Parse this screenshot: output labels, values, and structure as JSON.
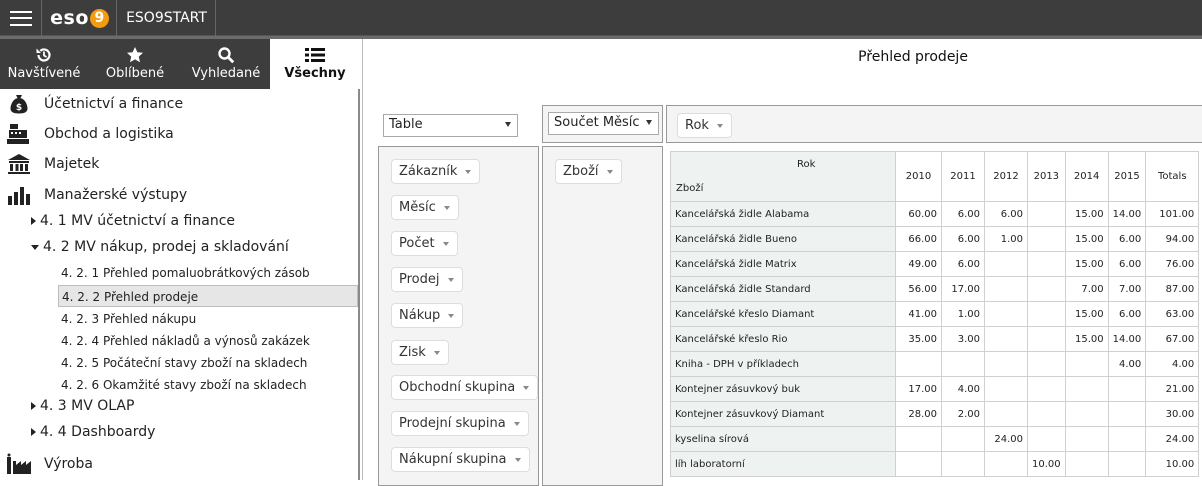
{
  "topbar": {
    "logo_text": "eso",
    "logo_digit": "9",
    "app_title": "ESO9START"
  },
  "tabs": [
    {
      "label": "Navštívené",
      "icon": "history-icon"
    },
    {
      "label": "Oblíbené",
      "icon": "star-icon"
    },
    {
      "label": "Vyhledané",
      "icon": "search-icon"
    },
    {
      "label": "Všechny",
      "icon": "list-icon"
    }
  ],
  "menu": {
    "top": [
      {
        "label": "Účetnictví a finance",
        "icon": "money-bag-icon"
      },
      {
        "label": "Obchod a logistika",
        "icon": "cash-register-icon"
      },
      {
        "label": "Majetek",
        "icon": "building-icon"
      },
      {
        "label": "Manažerské výstupy",
        "icon": "bar-chart-icon"
      }
    ],
    "sub1": "4. 1 MV účetnictví a finance",
    "sub2": "4. 2 MV nákup, prodej a skladování",
    "leaves": [
      "4. 2. 1 Přehled pomaluobrátkových zásob",
      "4. 2. 2 Přehled prodeje",
      "4. 2. 3 Přehled nákupu",
      "4. 2. 4 Přehled nákladů a výnosů zakázek",
      "4. 2. 5 Počáteční stavy zboží na skladech",
      "4. 2. 6 Okamžité stavy zboží na skladech"
    ],
    "sub3": "4. 3 MV OLAP",
    "sub4": "4. 4 Dashboardy",
    "last": {
      "label": "Výroba",
      "icon": "factory-icon"
    }
  },
  "pivot": {
    "title": "Přehled prodeje",
    "renderer": "Table",
    "aggregator": "Součet Měsíc",
    "col_attr": "Rok",
    "row_attr": "Zboží",
    "unused_attrs": [
      "Zákazník",
      "Měsíc",
      "Počet",
      "Prodej",
      "Nákup",
      "Zisk",
      "Obchodní skupina",
      "Prodejní skupina",
      "Nákupní skupina"
    ],
    "table": {
      "col_header": "Rok",
      "row_header": "Zboží",
      "years": [
        "2010",
        "2011",
        "2012",
        "2013",
        "2014",
        "2015"
      ],
      "totals_label": "Totals",
      "rows": [
        {
          "label": "Kancelářská židle Alabama",
          "values": [
            "60.00",
            "6.00",
            "6.00",
            "",
            "15.00",
            "14.00"
          ],
          "total": "101.00"
        },
        {
          "label": "Kancelářská židle Bueno",
          "values": [
            "66.00",
            "6.00",
            "1.00",
            "",
            "15.00",
            "6.00"
          ],
          "total": "94.00"
        },
        {
          "label": "Kancelářská židle Matrix",
          "values": [
            "49.00",
            "6.00",
            "",
            "",
            "15.00",
            "6.00"
          ],
          "total": "76.00"
        },
        {
          "label": "Kancelářská židle Standard",
          "values": [
            "56.00",
            "17.00",
            "",
            "",
            "7.00",
            "7.00"
          ],
          "total": "87.00"
        },
        {
          "label": "Kancelářské křeslo Diamant",
          "values": [
            "41.00",
            "1.00",
            "",
            "",
            "15.00",
            "6.00"
          ],
          "total": "63.00"
        },
        {
          "label": "Kancelářské křeslo Rio",
          "values": [
            "35.00",
            "3.00",
            "",
            "",
            "15.00",
            "14.00"
          ],
          "total": "67.00"
        },
        {
          "label": "Kniha - DPH v příkladech",
          "values": [
            "",
            "",
            "",
            "",
            "",
            "4.00"
          ],
          "total": "4.00"
        },
        {
          "label": "Kontejner zásuvkový buk",
          "values": [
            "17.00",
            "4.00",
            "",
            "",
            "",
            ""
          ],
          "total": "21.00"
        },
        {
          "label": "Kontejner zásuvkový Diamant",
          "values": [
            "28.00",
            "2.00",
            "",
            "",
            "",
            ""
          ],
          "total": "30.00"
        },
        {
          "label": "kyselina sírová",
          "values": [
            "",
            "",
            "24.00",
            "",
            "",
            ""
          ],
          "total": "24.00"
        },
        {
          "label": "líh laboratorní",
          "values": [
            "",
            "",
            "",
            "10.00",
            "",
            ""
          ],
          "total": "10.00"
        }
      ]
    }
  }
}
